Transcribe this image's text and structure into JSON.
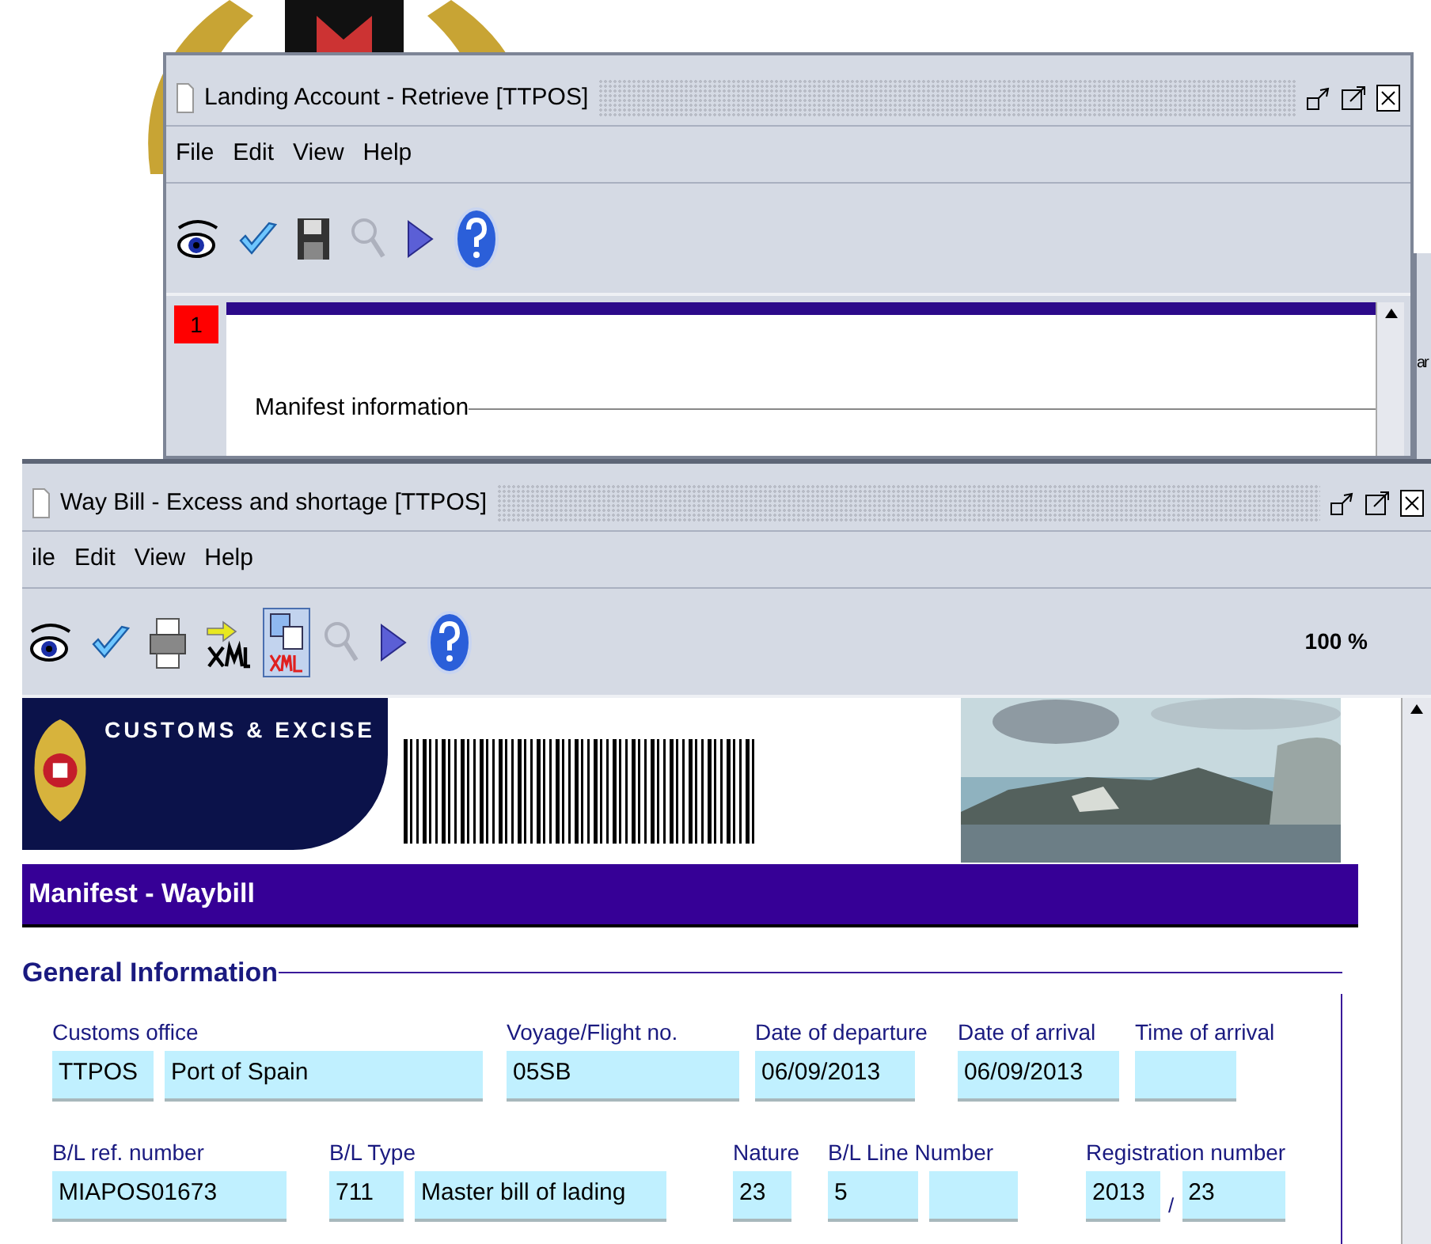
{
  "back_window": {
    "title": "Landing Account - Retrieve [TTPOS]",
    "menu": [
      "File",
      "Edit",
      "View",
      "Help"
    ],
    "toolbar": [
      {
        "kind": "eye",
        "disabled": false,
        "selected": false
      },
      {
        "kind": "check",
        "disabled": false,
        "selected": false
      },
      {
        "kind": "save",
        "disabled": false,
        "selected": false
      },
      {
        "kind": "search",
        "disabled": true,
        "selected": false
      },
      {
        "kind": "next",
        "disabled": false,
        "selected": false
      },
      {
        "kind": "help",
        "disabled": false,
        "selected": false
      }
    ],
    "tabs": [
      {
        "label": "1",
        "selected": true
      }
    ],
    "section": "Manifest information"
  },
  "side_window": {
    "text": "ar"
  },
  "front_window": {
    "title": "Way Bill - Excess and shortage [TTPOS]",
    "menu": [
      "ile",
      "Edit",
      "View",
      "Help"
    ],
    "toolbar": [
      {
        "kind": "eye",
        "disabled": false,
        "selected": false
      },
      {
        "kind": "check",
        "disabled": false,
        "selected": false
      },
      {
        "kind": "print",
        "disabled": false,
        "selected": false
      },
      {
        "kind": "xml_import",
        "disabled": false,
        "selected": false
      },
      {
        "kind": "xml_view",
        "disabled": false,
        "selected": true
      },
      {
        "kind": "search",
        "disabled": true,
        "selected": false
      },
      {
        "kind": "next",
        "disabled": false,
        "selected": false
      },
      {
        "kind": "help",
        "disabled": false,
        "selected": false
      }
    ],
    "zoom": "100 %",
    "brand": "CUSTOMS & EXCISE",
    "banner": "Manifest - Waybill",
    "section": "General Information",
    "rows": [
      [
        {
          "label": "Customs office",
          "fields": [
            "TTPOS",
            "Port of Spain"
          ]
        },
        {
          "label": "Voyage/Flight no.",
          "fields": [
            "05SB"
          ]
        },
        {
          "label": "Date of departure",
          "fields": [
            "06/09/2013"
          ]
        },
        {
          "label": "Date of arrival",
          "fields": [
            "06/09/2013"
          ]
        },
        {
          "label": "Time of arrival",
          "fields": [
            {
              "kind": "blank"
            }
          ]
        }
      ],
      [
        {
          "label": "B/L ref. number",
          "fields": [
            "MIAPOS01673"
          ]
        },
        {
          "label": "B/L Type",
          "fields": [
            "711",
            "Master bill of lading"
          ]
        },
        {
          "label": "Nature",
          "fields": [
            "23"
          ]
        },
        {
          "label": "B/L Line Number",
          "fields": [
            "5",
            {
              "kind": "blank"
            }
          ]
        },
        {
          "label": "Registration number",
          "fields": [
            "2013",
            "23"
          ],
          "separator": "/"
        }
      ]
    ]
  }
}
